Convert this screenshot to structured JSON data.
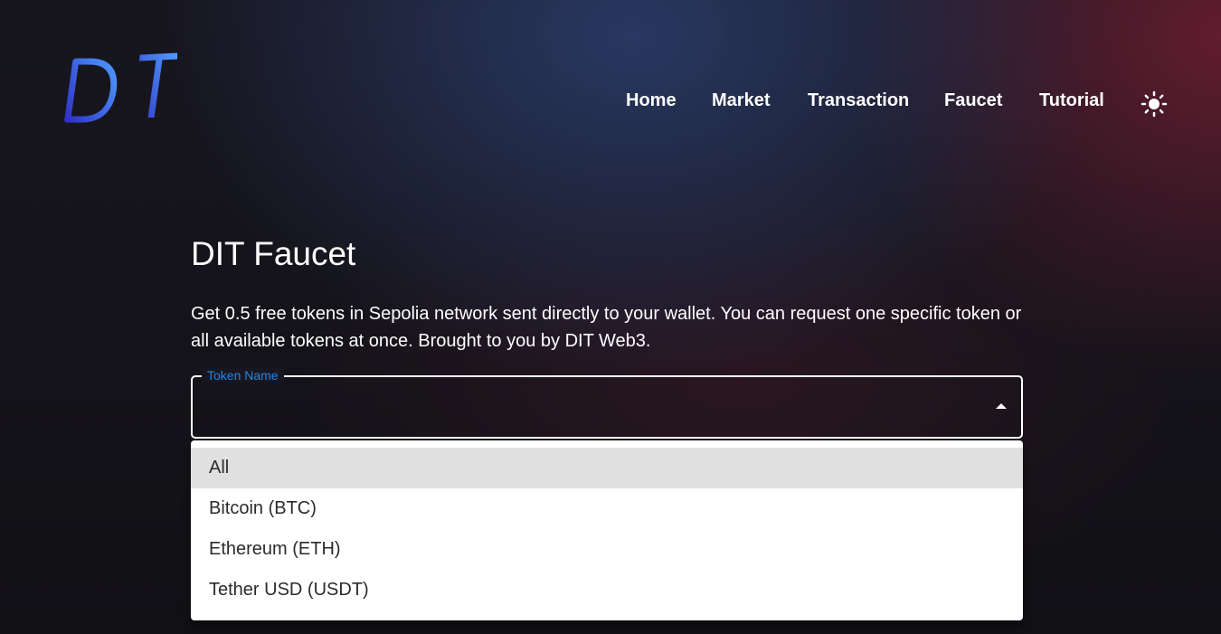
{
  "brand": {
    "logo_text": "DIT",
    "logo_colors": [
      "#3355dd",
      "#4aa4ff"
    ]
  },
  "nav": {
    "items": [
      {
        "label": "Home"
      },
      {
        "label": "Market"
      },
      {
        "label": "Transaction"
      },
      {
        "label": "Faucet"
      },
      {
        "label": "Tutorial"
      }
    ],
    "theme_toggle_icon": "sun-icon"
  },
  "main": {
    "title": "DIT Faucet",
    "description": "Get 0.5 free tokens in Sepolia network sent directly to your wallet. You can request one specific token or all available tokens at once. Brought to you by DIT Web3.",
    "token_select": {
      "label": "Token Name",
      "value": "",
      "accent_color": "#1e88e5",
      "options": [
        {
          "label": "All",
          "highlighted": true
        },
        {
          "label": "Bitcoin (BTC)",
          "highlighted": false
        },
        {
          "label": "Ethereum (ETH)",
          "highlighted": false
        },
        {
          "label": "Tether USD (USDT)",
          "highlighted": false
        }
      ]
    }
  }
}
